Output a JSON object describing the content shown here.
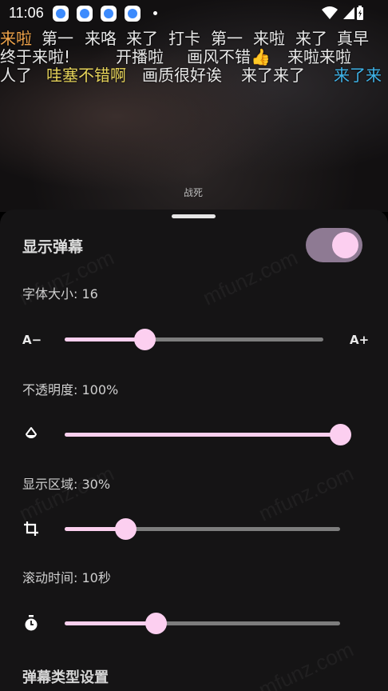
{
  "status_bar": {
    "time": "11:06"
  },
  "video": {
    "caption": "战死",
    "danmaku": [
      {
        "text": "来啦",
        "color": "#f0a44a"
      },
      {
        "text": "第一",
        "color": "#e8e8e8"
      },
      {
        "text": "来咯",
        "color": "#e8e8e8"
      },
      {
        "text": "来了",
        "color": "#e8e8e8"
      },
      {
        "text": "打卡",
        "color": "#e8e8e8"
      },
      {
        "text": "第一",
        "color": "#e8e8e8"
      },
      {
        "text": "来啦",
        "color": "#e8e8e8"
      },
      {
        "text": "来了",
        "color": "#e8e8e8"
      },
      {
        "text": "真早",
        "color": "#e8e8e8"
      },
      {
        "text": "终于来啦!",
        "color": "#e8e8e8"
      },
      {
        "text": "开播啦",
        "color": "#e8e8e8"
      },
      {
        "text": "画风不错👍",
        "color": "#e8e8e8"
      },
      {
        "text": "来啦来啦",
        "color": "#e8e8e8"
      },
      {
        "text": "人了",
        "color": "#e8e8e8"
      },
      {
        "text": "哇塞不错啊",
        "color": "#e6d35a"
      },
      {
        "text": "画质很好诶",
        "color": "#e8e8e8"
      },
      {
        "text": "来了来了",
        "color": "#e8e8e8"
      },
      {
        "text": "来了来",
        "color": "#3fb3e8"
      }
    ]
  },
  "sheet": {
    "show_danmaku_label": "显示弹幕",
    "show_danmaku_on": true,
    "font_size": {
      "label": "字体大小: 16",
      "min_label": "A−",
      "max_label": "A+",
      "value": 0.31
    },
    "opacity": {
      "label": "不透明度: 100%",
      "value": 1.0
    },
    "display_area": {
      "label": "显示区域: 30%",
      "value": 0.22
    },
    "scroll_time": {
      "label": "滚动时间: 10秒",
      "value": 0.33
    },
    "section_title": "弹幕类型设置",
    "icons": [
      "opacity-drop-icon",
      "crop-icon",
      "timer-icon"
    ],
    "accent_color": "#fccff0"
  }
}
